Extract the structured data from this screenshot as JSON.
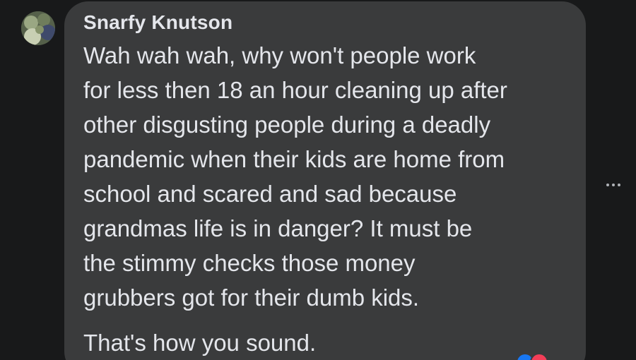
{
  "comment": {
    "author_name": "Snarfy Knutson",
    "paragraphs": [
      "Wah wah wah, why won't people work\nfor less then 18 an hour cleaning up after\nother disgusting people during a deadly\npandemic when their kids are home from\nschool and scared and sad because\ngrandmas life is in danger? It must be\nthe stimmy checks those money\ngrubbers got for their dumb kids.",
      "That's how you sound."
    ],
    "more_options_icon": "more-horizontal-icon",
    "reactions": [
      "like",
      "love"
    ]
  },
  "colors": {
    "background": "#18191a",
    "bubble": "#3a3b3c",
    "text": "#e4e6eb",
    "icon": "#b0b3b8",
    "like": "#1877f2",
    "love": "#f33e58"
  }
}
